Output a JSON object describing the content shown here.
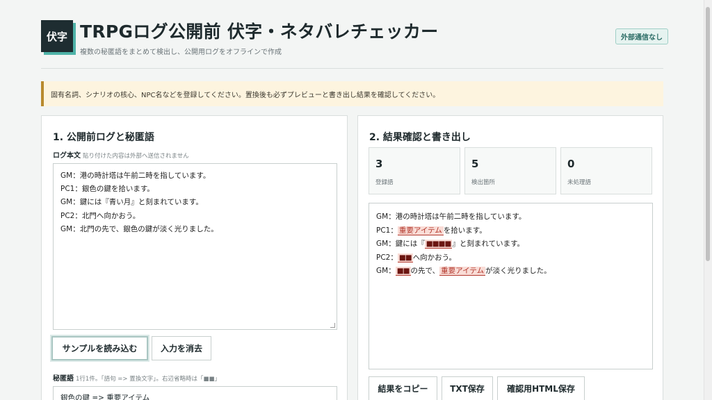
{
  "header": {
    "logo_text": "伏字",
    "title": "TRPGログ公開前 伏字・ネタバレチェッカー",
    "subtitle": "複数の秘匿語をまとめて検出し、公開用ログをオフラインで作成",
    "badge": "外部通信なし"
  },
  "notice": "固有名詞、シナリオの核心、NPC名などを登録してください。置換後も必ずプレビューと書き出し結果を確認してください。",
  "left_panel": {
    "heading": "1. 公開前ログと秘匿語",
    "log_label": "ログ本文",
    "log_hint": "貼り付けた内容は外部へ送信されません",
    "log_lines": [
      "GM：港の時計塔は午前二時を指しています。",
      "PC1：銀色の鍵を拾います。",
      "GM：鍵には『青い月』と刻まれています。",
      "PC2：北門へ向かおう。",
      "GM：北門の先で、銀色の鍵が淡く光りました。"
    ],
    "load_sample_button": "サンプルを読み込む",
    "clear_button": "入力を消去",
    "dict_label": "秘匿語",
    "dict_hint": "1行1件。「語句 => 置換文字」。右辺省略時は「■■」",
    "dict_first_line": "銀色の鍵 => 重要アイテム"
  },
  "right_panel": {
    "heading": "2. 結果確認と書き出し",
    "stats": [
      {
        "value": "3",
        "label": "登録語"
      },
      {
        "value": "5",
        "label": "検出箇所"
      },
      {
        "value": "0",
        "label": "未処理語"
      }
    ],
    "preview": {
      "l1": "GM：港の時計塔は午前二時を指しています。",
      "l2_pre": "PC1：",
      "l2_hl": "重要アイテム",
      "l2_post": "を拾います。",
      "l3_pre": "GM：鍵には『",
      "l3_mask": "■■■■",
      "l3_post": "』と刻まれています。",
      "l4_pre": "PC2：",
      "l4_mask": "■■",
      "l4_post": "へ向かおう。",
      "l5_pre": "GM：",
      "l5_mask": "■■",
      "l5_mid": "の先で、",
      "l5_hl": "重要アイテム",
      "l5_post": "が淡く光りました。"
    },
    "copy_button": "結果をコピー",
    "txt_button": "TXT保存",
    "html_button": "確認用HTML保存"
  },
  "colors": {
    "accent": "#4fb3a8",
    "highlight_bg": "#f9dcd6",
    "highlight_text": "#b2362b",
    "notice_border": "#b88a2e"
  }
}
